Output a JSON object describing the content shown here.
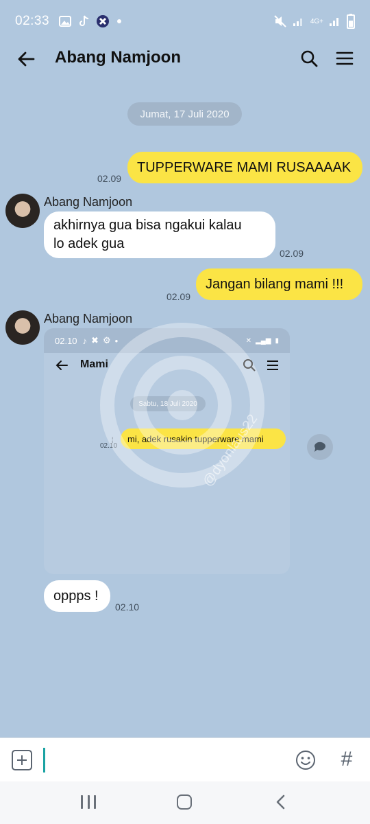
{
  "status_bar": {
    "time": "02:33",
    "network": "4G+",
    "icons": [
      "gallery-icon",
      "tiktok-icon",
      "app-icon",
      "dot-icon",
      "mute-icon",
      "signal-icon",
      "battery-icon"
    ]
  },
  "header": {
    "title": "Abang Namjoon",
    "icons": [
      "back-arrow-icon",
      "search-icon",
      "menu-icon"
    ]
  },
  "chat": {
    "date_separator": "Jumat, 17 Juli 2020",
    "messages": [
      {
        "side": "out",
        "text": "TUPPERWARE MAMI RUSAAAAK",
        "time": "02.09"
      },
      {
        "side": "in",
        "sender": "Abang Namjoon",
        "lines": [
          "akhirnya gua bisa ngakui kalau",
          "lo adek gua"
        ],
        "time": "02.09"
      },
      {
        "side": "out",
        "text": "Jangan bilang mami !!!",
        "time": "02.09"
      },
      {
        "side": "in",
        "sender": "Abang Namjoon",
        "type": "image"
      },
      {
        "side": "in",
        "text": "oppps !",
        "time": "02.10"
      }
    ]
  },
  "embedded_screenshot": {
    "status_time": "02.10",
    "title": "Mami",
    "date_separator": "Sabtu, 18 Juli 2020",
    "message": "mi, adek rusakin tupperware mami",
    "message_time": "02.10",
    "watermark": "@dyonlaus22"
  },
  "input_bar": {
    "placeholder": "",
    "value": ""
  },
  "colors": {
    "background": "#b0c7de",
    "outgoing_bubble": "#fbe445",
    "incoming_bubble": "#ffffff",
    "cursor": "#1aa3a3"
  }
}
